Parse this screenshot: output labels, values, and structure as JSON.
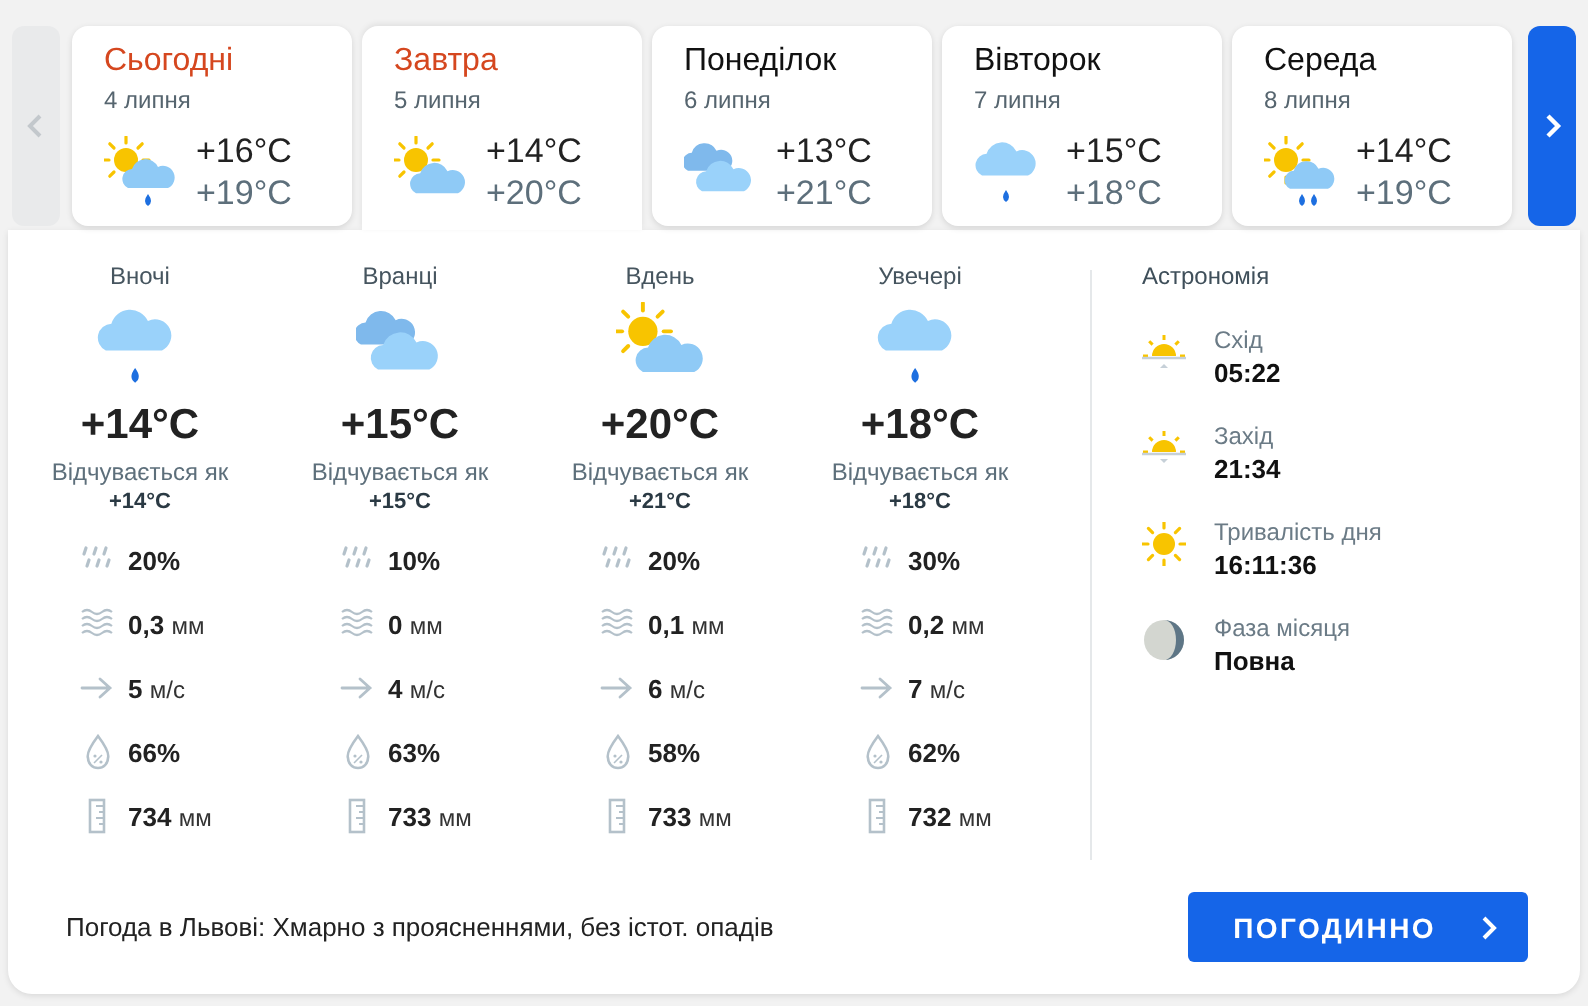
{
  "nav": {
    "prev_disabled": true
  },
  "days": [
    {
      "title": "Сьогодні",
      "accent": true,
      "date": "4 липня",
      "kind": "partly_rainy",
      "temp_max": "+16°C",
      "temp_min": "+19°C",
      "selected": false
    },
    {
      "title": "Завтра",
      "accent": true,
      "date": "5 липня",
      "kind": "partly_cloudy",
      "temp_max": "+14°C",
      "temp_min": "+20°C",
      "selected": true
    },
    {
      "title": "Понеділок",
      "accent": false,
      "date": "6 липня",
      "kind": "cloudy",
      "temp_max": "+13°C",
      "temp_min": "+21°C",
      "selected": false
    },
    {
      "title": "Вівторок",
      "accent": false,
      "date": "7 липня",
      "kind": "rainy",
      "temp_max": "+15°C",
      "temp_min": "+18°C",
      "selected": false
    },
    {
      "title": "Середа",
      "accent": false,
      "date": "8 липня",
      "kind": "showers",
      "temp_max": "+14°C",
      "temp_min": "+19°C",
      "selected": false
    }
  ],
  "periods": [
    {
      "label": "Вночі",
      "kind": "rainy",
      "temp": "+14°C",
      "feels_label": "Відчувається як",
      "feels": "+14°C",
      "details": [
        {
          "kind": "rain_chance",
          "value": "20%"
        },
        {
          "kind": "precipitation",
          "value": "0,3",
          "unit": "мм"
        },
        {
          "kind": "wind",
          "value": "5",
          "unit": "м/с"
        },
        {
          "kind": "humidity",
          "value": "66%"
        },
        {
          "kind": "pressure",
          "value": "734",
          "unit": "мм"
        }
      ]
    },
    {
      "label": "Вранці",
      "kind": "cloudy",
      "temp": "+15°C",
      "feels_label": "Відчувається як",
      "feels": "+15°C",
      "details": [
        {
          "kind": "rain_chance",
          "value": "10%"
        },
        {
          "kind": "precipitation",
          "value": "0",
          "unit": "мм"
        },
        {
          "kind": "wind",
          "value": "4",
          "unit": "м/с"
        },
        {
          "kind": "humidity",
          "value": "63%"
        },
        {
          "kind": "pressure",
          "value": "733",
          "unit": "мм"
        }
      ]
    },
    {
      "label": "Вдень",
      "kind": "partly_cloudy",
      "temp": "+20°C",
      "feels_label": "Відчувається як",
      "feels": "+21°C",
      "details": [
        {
          "kind": "rain_chance",
          "value": "20%"
        },
        {
          "kind": "precipitation",
          "value": "0,1",
          "unit": "мм"
        },
        {
          "kind": "wind",
          "value": "6",
          "unit": "м/с"
        },
        {
          "kind": "humidity",
          "value": "58%"
        },
        {
          "kind": "pressure",
          "value": "733",
          "unit": "мм"
        }
      ]
    },
    {
      "label": "Увечері",
      "kind": "rainy",
      "temp": "+18°C",
      "feels_label": "Відчувається як",
      "feels": "+18°C",
      "details": [
        {
          "kind": "rain_chance",
          "value": "30%"
        },
        {
          "kind": "precipitation",
          "value": "0,2",
          "unit": "мм"
        },
        {
          "kind": "wind",
          "value": "7",
          "unit": "м/с"
        },
        {
          "kind": "humidity",
          "value": "62%"
        },
        {
          "kind": "pressure",
          "value": "732",
          "unit": "мм"
        }
      ]
    }
  ],
  "astronomy": {
    "title": "Астрономія",
    "items": [
      {
        "kind": "sunrise",
        "label": "Схід",
        "value": "05:22"
      },
      {
        "kind": "sunset",
        "label": "Захід",
        "value": "21:34"
      },
      {
        "kind": "day_length",
        "label": "Тривалість дня",
        "value": "16:11:36"
      },
      {
        "kind": "moon",
        "label": "Фаза місяця",
        "value": "Повна"
      }
    ]
  },
  "summary": "Погода в Львові: Хмарно з проясненнями, без істот. опадів",
  "hourly_button": "ПОГОДИННО"
}
